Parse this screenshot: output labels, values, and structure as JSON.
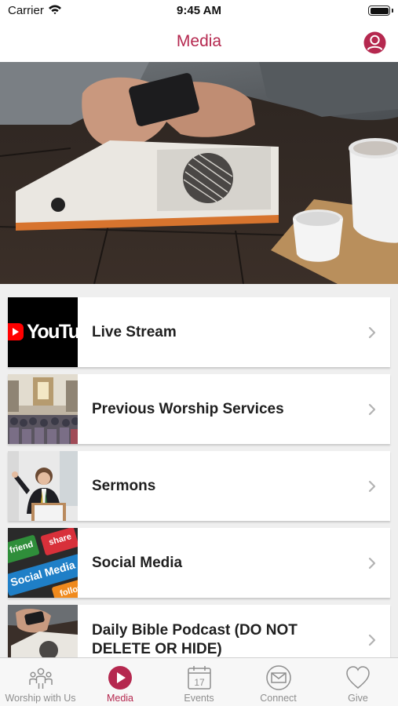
{
  "status_bar": {
    "carrier": "Carrier",
    "time": "9:45 AM"
  },
  "nav": {
    "title": "Media",
    "profile_icon": "person-circle-icon"
  },
  "colors": {
    "accent": "#b5284f",
    "tab_inactive": "#8e8e8e",
    "background": "#efefef"
  },
  "hero": {
    "icon": "phone-on-table-photo"
  },
  "media_items": [
    {
      "label": "Live Stream",
      "thumb": "YouTube",
      "icon": "youtube-thumbnail"
    },
    {
      "label": "Previous Worship Services",
      "icon": "church-congregation-thumbnail"
    },
    {
      "label": "Sermons",
      "icon": "pastor-preaching-thumbnail"
    },
    {
      "label": "Social Media",
      "thumb_words": [
        "friend",
        "share",
        "Social Media",
        "follow"
      ],
      "icon": "social-media-keys-thumbnail"
    },
    {
      "label": "Daily Bible Podcast (DO NOT DELETE OR HIDE)",
      "icon": "podcast-thumbnail"
    }
  ],
  "tabs": [
    {
      "label": "Worship with Us",
      "icon": "people-icon",
      "active": false
    },
    {
      "label": "Media",
      "icon": "play-circle-icon",
      "active": true
    },
    {
      "label": "Events",
      "icon": "calendar-icon",
      "date": "17",
      "active": false
    },
    {
      "label": "Connect",
      "icon": "envelope-circle-icon",
      "active": false
    },
    {
      "label": "Give",
      "icon": "heart-icon",
      "active": false
    }
  ]
}
